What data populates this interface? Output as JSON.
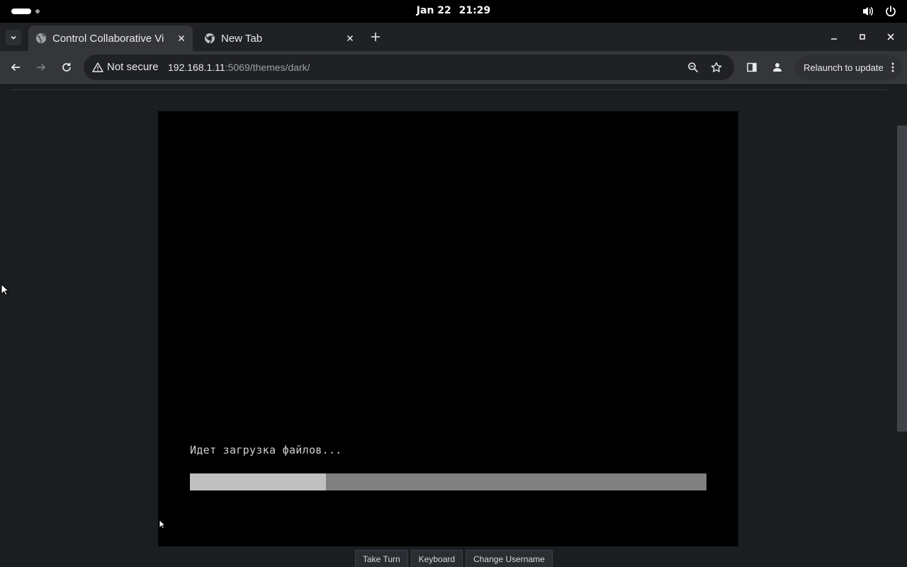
{
  "system_bar": {
    "date": "Jan 22",
    "time": "21:29",
    "icons": [
      "activities-indicator",
      "volume-icon",
      "power-icon"
    ]
  },
  "browser": {
    "tabs": [
      {
        "title": "Control Collaborative Vi",
        "favicon": "globe-icon",
        "active": true
      },
      {
        "title": "New Tab",
        "favicon": "chrome-icon",
        "active": false
      }
    ],
    "address_bar": {
      "security_label": "Not secure",
      "url_host": "192.168.1.11",
      "url_rest": ":5069/themes/dark/"
    },
    "relaunch_label": "Relaunch to update"
  },
  "vm": {
    "loading_text": "Идет загрузка файлов...",
    "progress_fraction": 0.264
  },
  "controls": {
    "take_turn": "Take Turn",
    "keyboard": "Keyboard",
    "change_username": "Change Username"
  },
  "colors": {
    "page_bg": "#1b1e21",
    "vm_bg": "#000000",
    "progress_fill": "#c0c0c0",
    "progress_track": "#808080"
  }
}
